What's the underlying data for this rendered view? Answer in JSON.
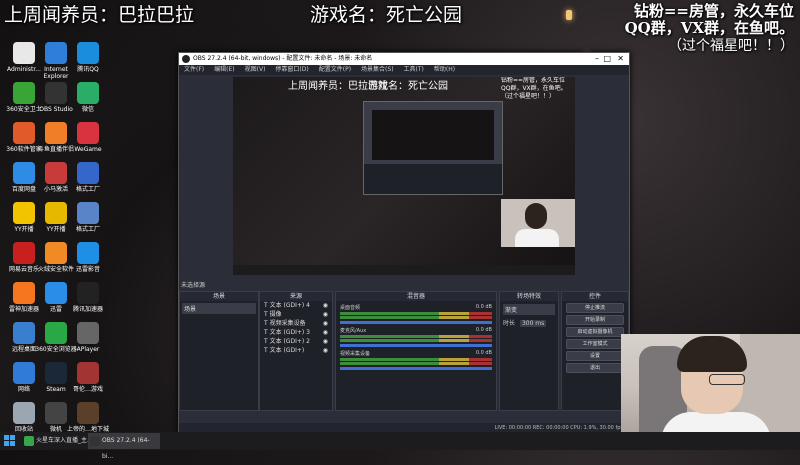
{
  "overlay": {
    "weekly": "上周闻养员：巴拉巴拉",
    "game": "游戏名：死亡公园",
    "fan_line1": "钻粉==房管，永久车位",
    "fan_line2": "QQ群，VX群，在鱼吧。",
    "fan_line3": "（过个福星吧！！）"
  },
  "desktop_icons": [
    {
      "label": "Administr...",
      "color": "#e8e8e8",
      "icon": "user-folder-icon"
    },
    {
      "label": "Internet Explorer",
      "color": "#2f7ed8",
      "icon": "ie-icon"
    },
    {
      "label": "腾讯QQ",
      "color": "#1a8ddb",
      "icon": "qq-icon"
    },
    {
      "label": "360安全卫士",
      "color": "#3aa537",
      "icon": "security-icon"
    },
    {
      "label": "OBS Studio",
      "color": "#333333",
      "icon": "obs-icon"
    },
    {
      "label": "微信",
      "color": "#2aae67",
      "icon": "wechat-icon"
    },
    {
      "label": "360软件管家",
      "color": "#e05a2a",
      "icon": "software-manager-icon"
    },
    {
      "label": "斗鱼直播伴侣",
      "color": "#f07d28",
      "icon": "douyu-icon"
    },
    {
      "label": "WeGame",
      "color": "#d8333f",
      "icon": "wegame-icon"
    },
    {
      "label": "百度网盘",
      "color": "#2e8be6",
      "icon": "cloud-icon"
    },
    {
      "label": "小马激活",
      "color": "#c73b3b",
      "icon": "activator-icon"
    },
    {
      "label": "格式工厂",
      "color": "#3467c9",
      "icon": "format-factory-icon"
    },
    {
      "label": "YY开播",
      "color": "#f2c400",
      "icon": "yy-icon"
    },
    {
      "label": "YY开播",
      "color": "#e6b800",
      "icon": "yy-live-icon"
    },
    {
      "label": "格式工厂",
      "color": "#5a84c8",
      "icon": "factory-icon"
    },
    {
      "label": "网易云音乐",
      "color": "#c8201e",
      "icon": "music-icon"
    },
    {
      "label": "火绒安全软件",
      "color": "#f08a24",
      "icon": "huorong-icon"
    },
    {
      "label": "迅雷影音",
      "color": "#1f8fe6",
      "icon": "thunder-icon"
    },
    {
      "label": "雷神加速器",
      "color": "#f5761f",
      "icon": "accelerator-icon"
    },
    {
      "label": "迅雷",
      "color": "#2a8ee8",
      "icon": "bird-icon"
    },
    {
      "label": "腾讯加速器",
      "color": "#222222",
      "icon": "game-accelerator-icon"
    },
    {
      "label": "远程桌面",
      "color": "#3a7ed0",
      "icon": "remote-icon"
    },
    {
      "label": "360安全浏览器",
      "color": "#2aa845",
      "icon": "browser-icon"
    },
    {
      "label": "APlayer",
      "color": "#666666",
      "icon": "player-icon"
    },
    {
      "label": "网络",
      "color": "#2f7bd6",
      "icon": "network-icon"
    },
    {
      "label": "Steam",
      "color": "#1b2838",
      "icon": "steam-icon"
    },
    {
      "label": "哥伦…游戏",
      "color": "#a33434",
      "icon": "game-icon"
    },
    {
      "label": "回收站",
      "color": "#9aa6b2",
      "icon": "recycle-bin-icon"
    },
    {
      "label": "微机",
      "color": "#444444",
      "icon": "computer-icon"
    },
    {
      "label": "上帝的…地下城",
      "color": "#5a3f2b",
      "icon": "dungeon-icon"
    }
  ],
  "obs": {
    "title": "OBS 27.2.4 (64-bit, windows) - 配置文件: 未命名 - 场景: 未命名",
    "menu": [
      "文件(F)",
      "编辑(E)",
      "视图(V)",
      "停靠窗口(D)",
      "配置文件(P)",
      "场景集合(S)",
      "工具(T)",
      "帮助(H)"
    ],
    "docks": {
      "scenes_title": "场景",
      "scene_item": "场景",
      "sources_title": "来源",
      "sources": [
        "文本 (GDI+) 4",
        "摄像",
        "视频采集设备",
        "文本 (GDI+) 3",
        "文本 (GDI+) 2",
        "文本 (GDI+)"
      ],
      "mixer_title": "混音器",
      "mixer": [
        {
          "name": "桌面音频",
          "level": "0.0 dB"
        },
        {
          "name": "麦克风/Aux",
          "level": "0.0 dB"
        },
        {
          "name": "视频采集设备",
          "level": "0.0 dB"
        }
      ],
      "transition_title": "转场特效",
      "transition_value": "渐变",
      "duration_label": "时长",
      "duration_value": "300 ms",
      "controls_title": "控件",
      "controls": [
        "停止推流",
        "开始录制",
        "启动虚拟摄像机",
        "工作室模式",
        "设置",
        "退出"
      ]
    },
    "scene_label": "未选择源",
    "status": "LIVE: 00:00:00   REC: 00:00:00   CPU: 1.9%, 30.00 fps"
  },
  "taskbar": {
    "items": [
      {
        "label": "火星车深入直播_主...",
        "color": "#35a84a",
        "icon": "live-icon"
      },
      {
        "label": "OBS 27.2.4 (64-bi...",
        "color": "#333333",
        "icon": "obs-icon"
      }
    ]
  }
}
